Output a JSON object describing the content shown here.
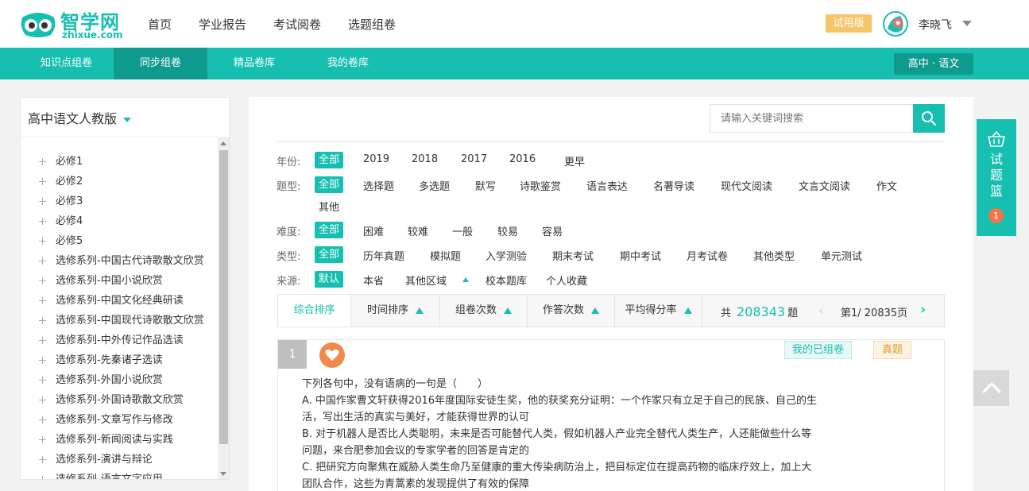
{
  "brand": {
    "title": "智学网",
    "subtitle": "zhixue.com"
  },
  "top_nav": [
    {
      "label": "首页"
    },
    {
      "label": "学业报告"
    },
    {
      "label": "考试阅卷"
    },
    {
      "label": "选题组卷"
    }
  ],
  "user": {
    "trial_label": "试用版",
    "name": "李晓飞"
  },
  "sub_nav": [
    {
      "label": "知识点组卷"
    },
    {
      "label": "同步组卷",
      "active": true
    },
    {
      "label": "精品卷库"
    },
    {
      "label": "我的卷库"
    }
  ],
  "grade_subject": "高中 · 语文",
  "textbook": "高中语文人教版",
  "tree_items": [
    "必修1",
    "必修2",
    "必修3",
    "必修4",
    "必修5",
    "选修系列-中国古代诗歌散文欣赏",
    "选修系列-中国小说欣赏",
    "选修系列-中国文化经典研读",
    "选修系列-中国现代诗歌散文欣赏",
    "选修系列-中外传记作品选读",
    "选修系列-先秦诸子选读",
    "选修系列-外国小说欣赏",
    "选修系列-外国诗歌散文欣赏",
    "选修系列-文章写作与修改",
    "选修系列-新闻阅读与实践",
    "选修系列-演讲与辩论",
    "选修系列-语言文字应用"
  ],
  "search": {
    "placeholder": "请输入关键词搜索"
  },
  "filters": {
    "year": {
      "label": "年份:",
      "options": [
        "全部",
        "2019",
        "2018",
        "2017",
        "2016",
        "更早"
      ]
    },
    "type": {
      "label": "题型:",
      "options": [
        "全部",
        "选择题",
        "多选题",
        "默写",
        "诗歌鉴赏",
        "语言表达",
        "名著导读",
        "现代文阅读",
        "文言文阅读",
        "作文",
        "其他"
      ]
    },
    "difficulty": {
      "label": "难度:",
      "options": [
        "全部",
        "困难",
        "较难",
        "一般",
        "较易",
        "容易"
      ]
    },
    "category": {
      "label": "类型:",
      "options": [
        "全部",
        "历年真题",
        "模拟题",
        "入学测验",
        "期末考试",
        "期中考试",
        "月考试卷",
        "其他类型",
        "单元测试"
      ]
    },
    "source": {
      "label": "来源:",
      "options": [
        "默认",
        "本省",
        "其他区域",
        "校本题库",
        "个人收藏"
      ]
    }
  },
  "sort": {
    "items": [
      "综合排序",
      "时间排序",
      "组卷次数",
      "作答次数",
      "平均得分率"
    ],
    "count_prefix": "共",
    "count": "208343",
    "count_suffix": "题",
    "page_text": "第1/ 20835页"
  },
  "question": {
    "number": "1",
    "tag_mine": "我的已组卷",
    "tag_real": "真题",
    "lines": [
      "下列各句中，没有语病的一句是（　　）",
      "A. 中国作家曹文轩获得2016年度国际安徒生奖，他的获奖充分证明：一个作家只有立足于自己的民族、自己的生",
      "活，写出生活的真实与美好，才能获得世界的认可",
      "B. 对于机器人是否比人类聪明，未来是否可能替代人类，假如机器人产业完全替代人类生产，人还能做些什么等",
      "问题，来合肥参加会议的专家学者的回答是肯定的",
      "C. 把研究方向聚焦在威胁人类生命乃至健康的重大传染病防治上，把目标定位在提高药物的临床疗效上，加上大",
      "团队合作，这些为青蒿素的发现提供了有效的保障"
    ]
  },
  "basket": {
    "label_chars": [
      "试",
      "题",
      "篮"
    ],
    "count": "1"
  },
  "colors": {
    "accent": "#16bfb0",
    "accent_dark": "#0f9a8e",
    "trial": "#f5c66a",
    "fav": "#f08a4b"
  }
}
